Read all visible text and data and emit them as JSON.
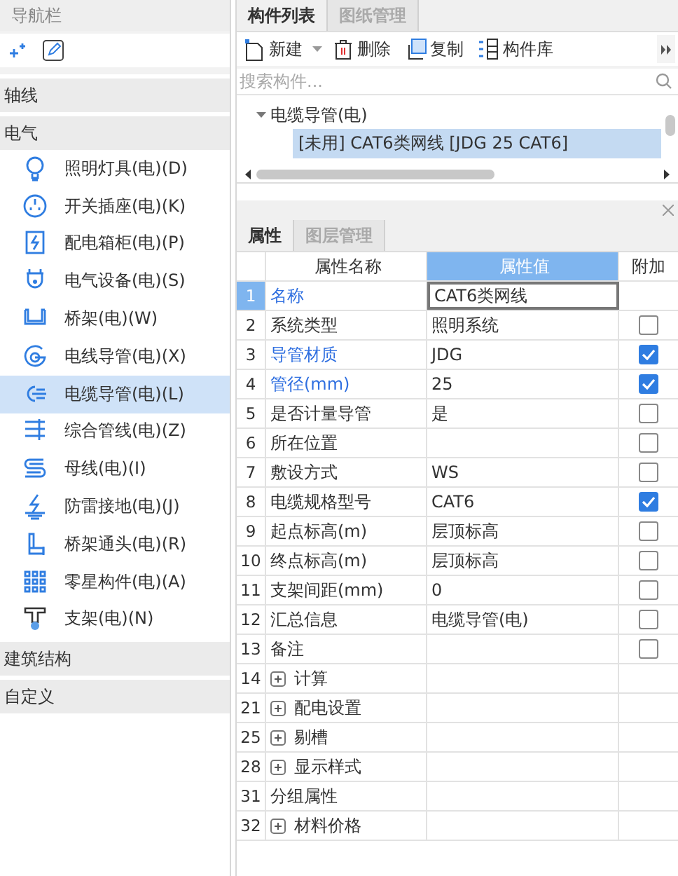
{
  "nav": {
    "title": "导航栏",
    "categories": [
      {
        "label": "轴线"
      },
      {
        "label": "电气",
        "items": [
          {
            "label": "照明灯具(电)(D)",
            "selected": false
          },
          {
            "label": "开关插座(电)(K)",
            "selected": false
          },
          {
            "label": "配电箱柜(电)(P)",
            "selected": false
          },
          {
            "label": "电气设备(电)(S)",
            "selected": false
          },
          {
            "label": "桥架(电)(W)",
            "selected": false
          },
          {
            "label": "电线导管(电)(X)",
            "selected": false
          },
          {
            "label": "电缆导管(电)(L)",
            "selected": true
          },
          {
            "label": "综合管线(电)(Z)",
            "selected": false
          },
          {
            "label": "母线(电)(I)",
            "selected": false
          },
          {
            "label": "防雷接地(电)(J)",
            "selected": false
          },
          {
            "label": "桥架通头(电)(R)",
            "selected": false
          },
          {
            "label": "零星构件(电)(A)",
            "selected": false
          },
          {
            "label": "支架(电)(N)",
            "selected": false
          }
        ]
      },
      {
        "label": "建筑结构"
      },
      {
        "label": "自定义"
      }
    ]
  },
  "component_panel": {
    "tabs": [
      {
        "label": "构件列表",
        "selected": true
      },
      {
        "label": "图纸管理",
        "selected": false
      }
    ],
    "toolbar": [
      "新建",
      "删除",
      "复制",
      "构件库"
    ],
    "search": {
      "placeholder": "搜索构件..."
    },
    "tree": [
      {
        "label": "电缆导管(电)",
        "expanded": true,
        "children": [
          {
            "label": "[未用] CAT6类网线 [JDG 25 CAT6]",
            "selected": true
          }
        ]
      }
    ]
  },
  "property_panel": {
    "tabs": [
      {
        "label": "属性",
        "selected": true
      },
      {
        "label": "图层管理",
        "selected": false
      }
    ],
    "columns": [
      "属性名称",
      "属性值",
      "附加"
    ],
    "rows": [
      {
        "kind": "field",
        "number": "1",
        "name": "名称",
        "value": "CAT6类网线",
        "highlight": true,
        "selected": true
      },
      {
        "kind": "field",
        "number": "2",
        "name": "系统类型",
        "value": "照明系统",
        "highlight": false,
        "selected": false,
        "checked": false
      },
      {
        "kind": "field",
        "number": "3",
        "name": "导管材质",
        "value": "JDG",
        "highlight": true,
        "selected": false,
        "checked": true
      },
      {
        "kind": "field",
        "number": "4",
        "name": "管径(mm)",
        "value": "25",
        "highlight": true,
        "selected": false,
        "checked": true
      },
      {
        "kind": "field",
        "number": "5",
        "name": "是否计量导管",
        "value": "是",
        "highlight": false,
        "selected": false,
        "checked": false
      },
      {
        "kind": "field",
        "number": "6",
        "name": "所在位置",
        "highlight": false,
        "selected": false,
        "checked": false
      },
      {
        "kind": "field",
        "number": "7",
        "name": "敷设方式",
        "value": "WS",
        "highlight": false,
        "selected": false,
        "checked": false
      },
      {
        "kind": "field",
        "number": "8",
        "name": "电缆规格型号",
        "value": "CAT6",
        "highlight": false,
        "selected": false,
        "checked": true
      },
      {
        "kind": "field",
        "number": "9",
        "name": "起点标高(m)",
        "value": "层顶标高",
        "highlight": false,
        "selected": false,
        "checked": false
      },
      {
        "kind": "field",
        "number": "10",
        "name": "终点标高(m)",
        "value": "层顶标高",
        "highlight": false,
        "selected": false,
        "checked": false
      },
      {
        "kind": "field",
        "number": "11",
        "name": "支架间距(mm)",
        "value": "0",
        "highlight": false,
        "selected": false,
        "checked": false
      },
      {
        "kind": "field",
        "number": "12",
        "name": "汇总信息",
        "value": "电缆导管(电)",
        "highlight": false,
        "selected": false,
        "checked": false
      },
      {
        "kind": "field",
        "number": "13",
        "name": "备注",
        "highlight": false,
        "selected": false,
        "checked": false
      },
      {
        "kind": "group",
        "number": "14",
        "name": "计算",
        "selected": false
      },
      {
        "kind": "group",
        "number": "21",
        "name": "配电设置",
        "selected": false
      },
      {
        "kind": "group",
        "number": "25",
        "name": "剔槽",
        "selected": false
      },
      {
        "kind": "group",
        "number": "28",
        "name": "显示样式",
        "selected": false
      },
      {
        "kind": "plain",
        "number": "31",
        "name": "分组属性",
        "selected": false
      },
      {
        "kind": "group",
        "number": "32",
        "name": "材料价格",
        "selected": false
      }
    ]
  }
}
